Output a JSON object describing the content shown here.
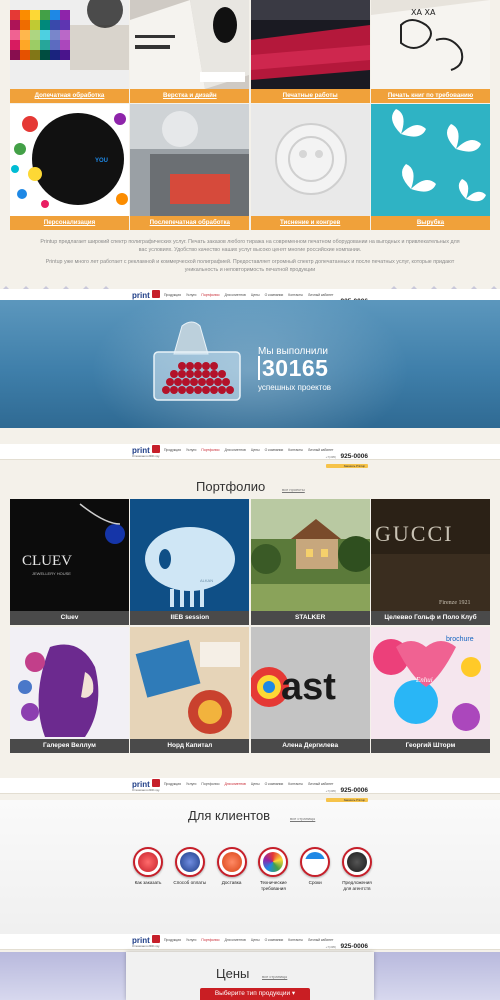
{
  "services": [
    {
      "label": "Допечатная обработка"
    },
    {
      "label": "Верстка и дизайн"
    },
    {
      "label": "Печатные работы"
    },
    {
      "label": "Печать книг по требованию"
    },
    {
      "label": "Персонализация"
    },
    {
      "label": "Послепечатная обработка"
    },
    {
      "label": "Тиснение и конгрев"
    },
    {
      "label": "Вырубка"
    }
  ],
  "about": {
    "p1": "Printup предлагает широкий спектр полиграфических услуг. Печать заказов любого тиража на современном печатном оборудовании на выгодных и привлекательных для вас условиях. Удобство качество наших услуг высоко ценят многие российские компании.",
    "p2": "Printup уже много лет работает с рекламной и коммерческой полиграфией. Предоставляет огромный спектр допечатанных и после печатных услуг, которые придают уникальность и неповторимость печатной продукции"
  },
  "header": {
    "logo": "print",
    "slogan": "Отпечатано в 2000 году",
    "nav": [
      "Продукция",
      "Услуги",
      "Портфолио",
      "Для клиентов",
      "Цены",
      "О компании",
      "Контакты",
      "Личный кабинет"
    ],
    "active_nav": "Портфолио",
    "phone_prefix": "+7(495)",
    "phone": "925-0006",
    "order": "Заказать Printup"
  },
  "hero": {
    "title": "Мы выполнили",
    "number": "30165",
    "subtitle": "успешных проектов"
  },
  "portfolio": {
    "title": "Портфолио",
    "link": "все проекты",
    "items": [
      {
        "label": "Cluev",
        "art_text": "CLUEV",
        "art_sub": "JEWELLERY HOUSE"
      },
      {
        "label": "IIEB session",
        "art_text": "ALKAN"
      },
      {
        "label": "STALKER"
      },
      {
        "label": "Целевво Гольф и Поло Клуб",
        "art_text": "GUCCI",
        "art_sub": "Firenze 1921"
      },
      {
        "label": "Галерея Веллум"
      },
      {
        "label": "Норд Капитал"
      },
      {
        "label": "Алена Дергилева",
        "art_text": "ast"
      },
      {
        "label": "Георгий Шторм",
        "art_text": "brochure",
        "art_sub": "Enhui"
      }
    ]
  },
  "clients": {
    "title": "Для клиентов",
    "link": "все страницы",
    "items": [
      {
        "label": "Как заказать",
        "icon": "cart-icon"
      },
      {
        "label": "Способ оплаты",
        "icon": "visa-icon"
      },
      {
        "label": "Доставка",
        "icon": "truck-icon"
      },
      {
        "label": "Технические требования",
        "icon": "gear-icon"
      },
      {
        "label": "Сроки",
        "icon": "calendar-icon"
      },
      {
        "label": "Предложения для агентств",
        "icon": "briefcase-icon"
      }
    ]
  },
  "prices": {
    "title": "Цены",
    "link": "все страницы",
    "select": "Выберите тип продукции"
  },
  "colors": {
    "accent_orange": "#f0a13a",
    "accent_red": "#c91e23",
    "brand_blue": "#1d3c86",
    "hero_blue": "#3f7faa"
  }
}
